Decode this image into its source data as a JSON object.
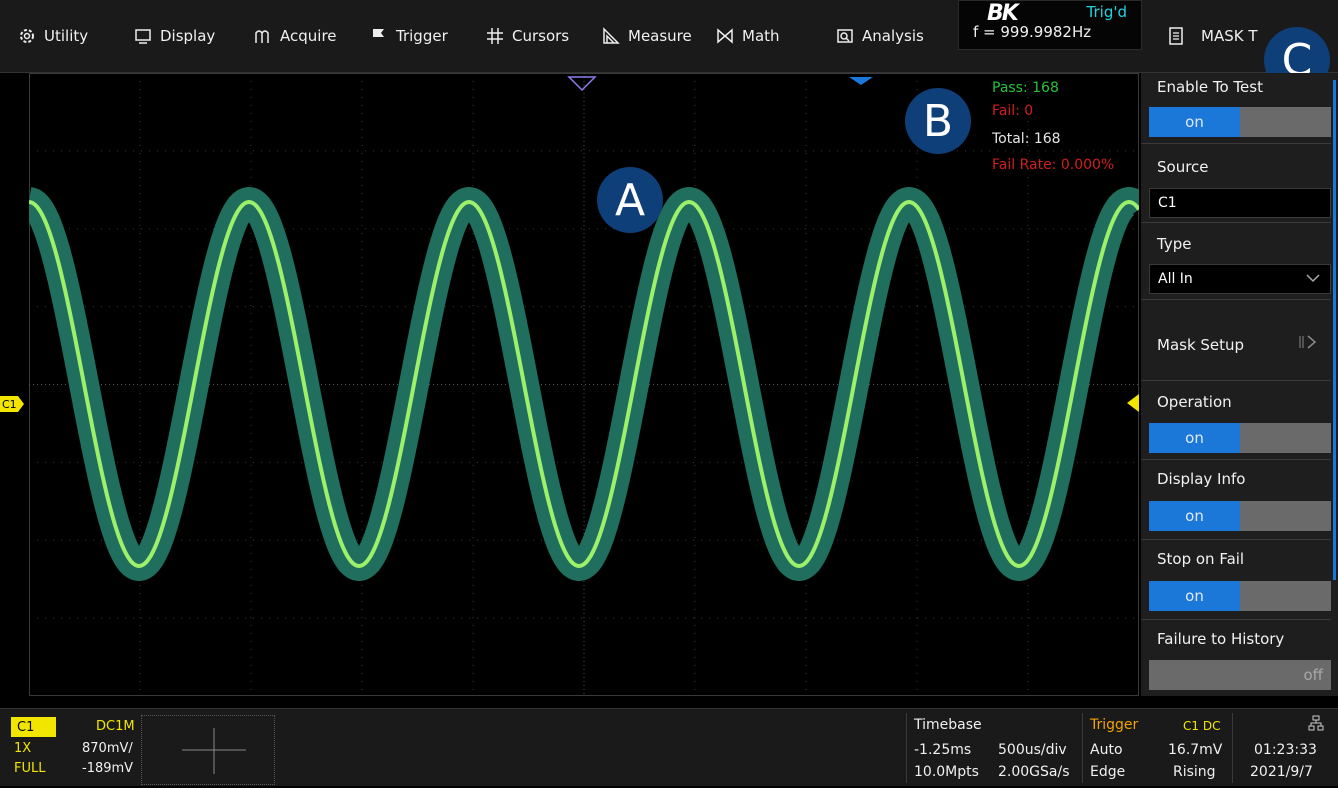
{
  "menu": {
    "utility": "Utility",
    "display": "Display",
    "acquire": "Acquire",
    "trigger": "Trigger",
    "cursors": "Cursors",
    "measure": "Measure",
    "math": "Math",
    "analysis": "Analysis"
  },
  "status": {
    "logo": "BK",
    "trig_state": "Trig'd",
    "frequency": "f = 999.9982Hz"
  },
  "panel_title": "MASK T",
  "pass_fail": {
    "pass": "Pass: 168",
    "fail": "Fail: 0",
    "total": "Total: 168",
    "fail_rate": "Fail Rate: 0.000%"
  },
  "callouts": {
    "a": "A",
    "b": "B",
    "c": "C"
  },
  "panel": {
    "enable_label": "Enable To Test",
    "enable_value": "on",
    "source_label": "Source",
    "source_value": "C1",
    "type_label": "Type",
    "type_value": "All In",
    "mask_setup_label": "Mask Setup",
    "operation_label": "Operation",
    "operation_value": "on",
    "display_info_label": "Display Info",
    "display_info_value": "on",
    "stop_on_fail_label": "Stop on Fail",
    "stop_on_fail_value": "on",
    "failure_history_label": "Failure to History",
    "failure_history_value": "off"
  },
  "channel": {
    "name": "C1",
    "coupling": "DC1M",
    "probe": "1X",
    "scale": "870mV/",
    "bandwidth": "FULL",
    "offset": "-189mV",
    "marker": "C1"
  },
  "timebase": {
    "label": "Timebase",
    "delay": "-1.25ms",
    "scale": "500us/div",
    "memory": "10.0Mpts",
    "sample_rate": "2.00GSa/s"
  },
  "trigger": {
    "label": "Trigger",
    "source": "C1 DC",
    "mode": "Auto",
    "level": "16.7mV",
    "type": "Edge",
    "slope": "Rising"
  },
  "clock": {
    "time": "01:23:33",
    "date": "2021/9/7"
  },
  "colors": {
    "trace": "#9cf06a",
    "mask": "#1f6e5e",
    "channel": "#f2e600",
    "accent": "#1b78d8"
  }
}
